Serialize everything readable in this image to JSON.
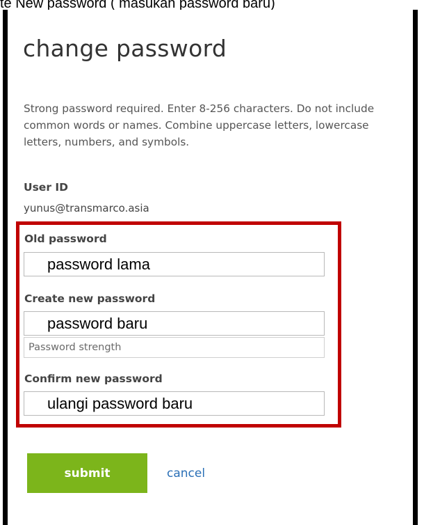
{
  "caption": "te New password ( masukan password baru)",
  "form": {
    "title": "change password",
    "description": "Strong password required. Enter 8-256 characters. Do not include common words or names. Combine uppercase letters, lowercase letters, numbers, and symbols.",
    "user_id_label": "User ID",
    "user_id_value": "yunus@transmarco.asia",
    "old_password": {
      "label": "Old password",
      "value": "password lama"
    },
    "new_password": {
      "label": "Create new password",
      "value": "password baru"
    },
    "strength_label": "Password strength",
    "confirm_password": {
      "label": "Confirm new password",
      "value": "ulangi password baru"
    },
    "submit_label": "submit",
    "cancel_label": "cancel"
  },
  "colors": {
    "highlight_border": "#c00000",
    "submit_bg": "#7cb51b",
    "cancel_link": "#2a6fb6"
  }
}
